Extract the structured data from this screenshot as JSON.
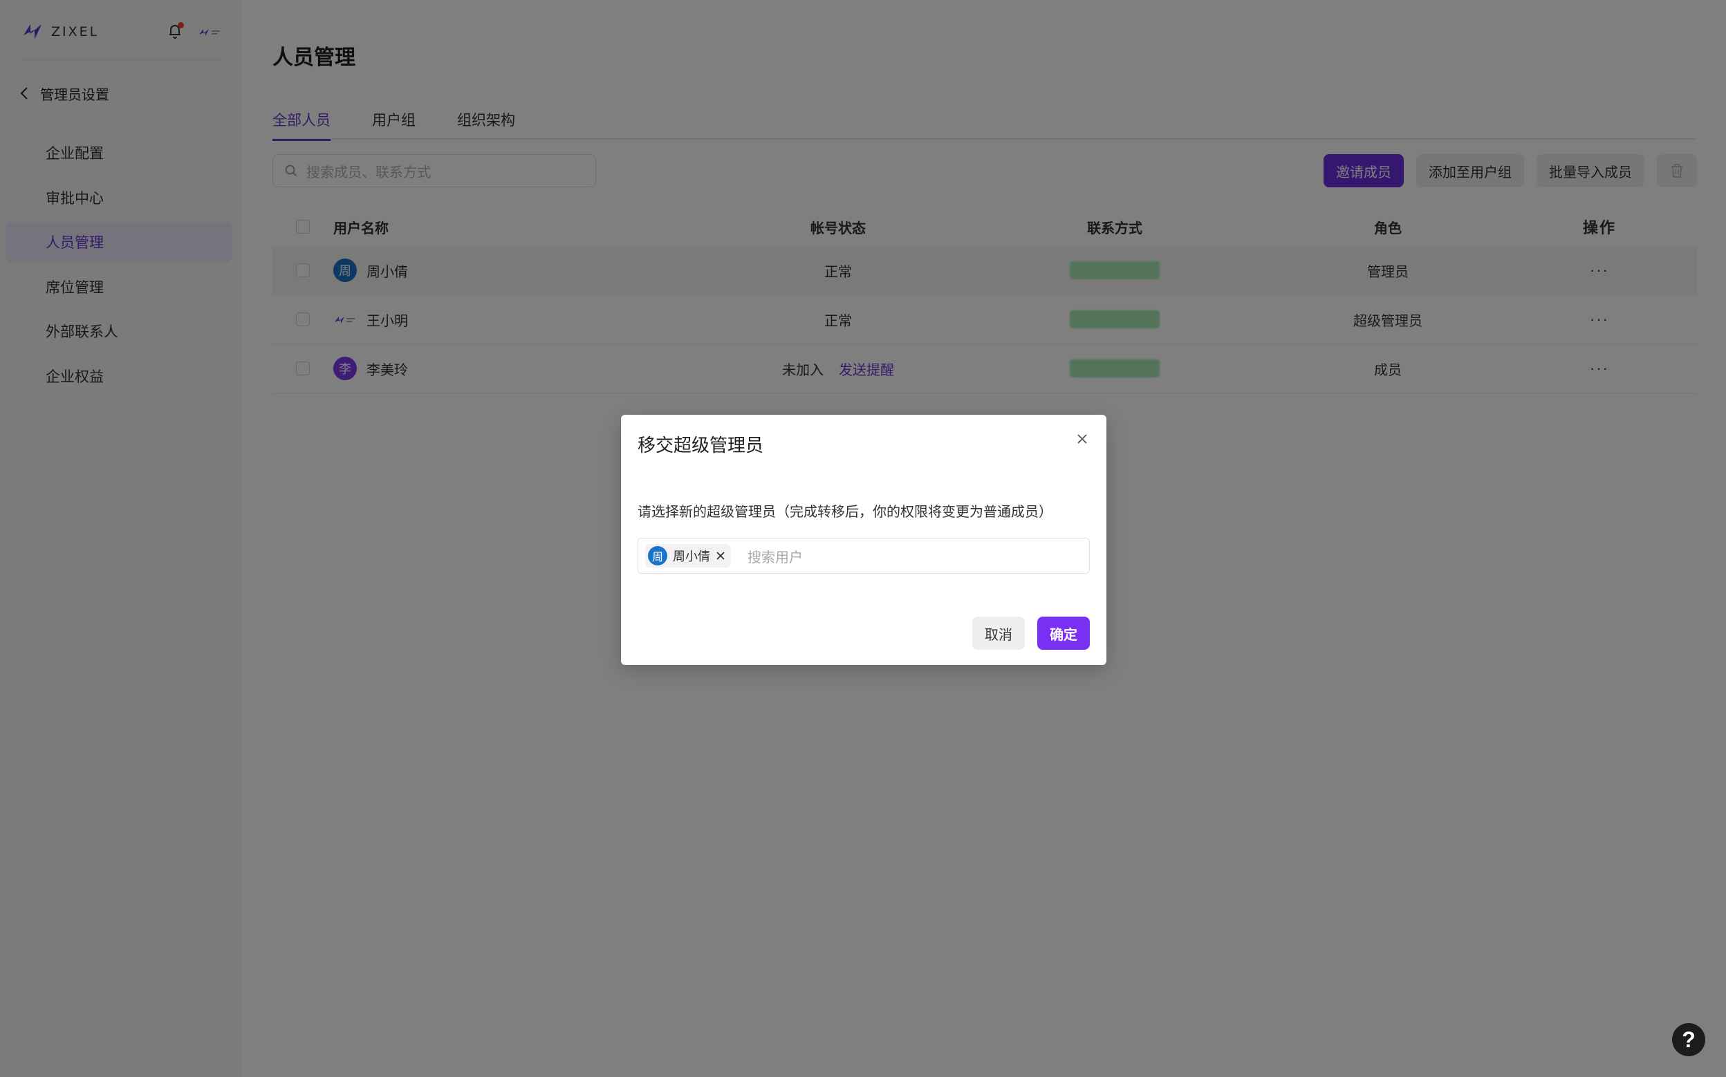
{
  "brand": {
    "logo_text": "ZIXEL"
  },
  "sidebar": {
    "back_label": "管理员设置",
    "items": [
      {
        "label": "企业配置"
      },
      {
        "label": "审批中心"
      },
      {
        "label": "人员管理",
        "active": true
      },
      {
        "label": "席位管理"
      },
      {
        "label": "外部联系人"
      },
      {
        "label": "企业权益"
      }
    ]
  },
  "main": {
    "title": "人员管理",
    "tabs": [
      {
        "label": "全部人员",
        "active": true
      },
      {
        "label": "用户组"
      },
      {
        "label": "组织架构"
      }
    ],
    "search": {
      "placeholder": "搜索成员、联系方式"
    },
    "buttons": {
      "invite": "邀请成员",
      "add_to_group": "添加至用户组",
      "batch_import": "批量导入成员"
    },
    "table": {
      "headers": [
        "用户名称",
        "帐号状态",
        "联系方式",
        "角色",
        "操作"
      ],
      "rows": [
        {
          "avatar_char": "周",
          "name": "周小倩",
          "status": "正常",
          "role": "管理员",
          "op": "···"
        },
        {
          "avatar_char": "",
          "name": "王小明",
          "status": "正常",
          "role": "超级管理员",
          "op": "···"
        },
        {
          "avatar_char": "李",
          "name": "李美玲",
          "status": "未加入",
          "status_action": "发送提醒",
          "role": "成员",
          "op": "···"
        }
      ]
    }
  },
  "modal": {
    "title": "移交超级管理员",
    "description": "请选择新的超级管理员（完成转移后，你的权限将变更为普通成员）",
    "selected_user": {
      "avatar_char": "周",
      "name": "周小倩"
    },
    "search_placeholder": "搜索用户",
    "cancel": "取消",
    "confirm": "确定"
  },
  "help": {
    "label": "?"
  },
  "colors": {
    "accent": "#6a3bd0",
    "primary_button": "#6a2ee0",
    "overlay": "rgba(0,0,0,0.5)"
  }
}
